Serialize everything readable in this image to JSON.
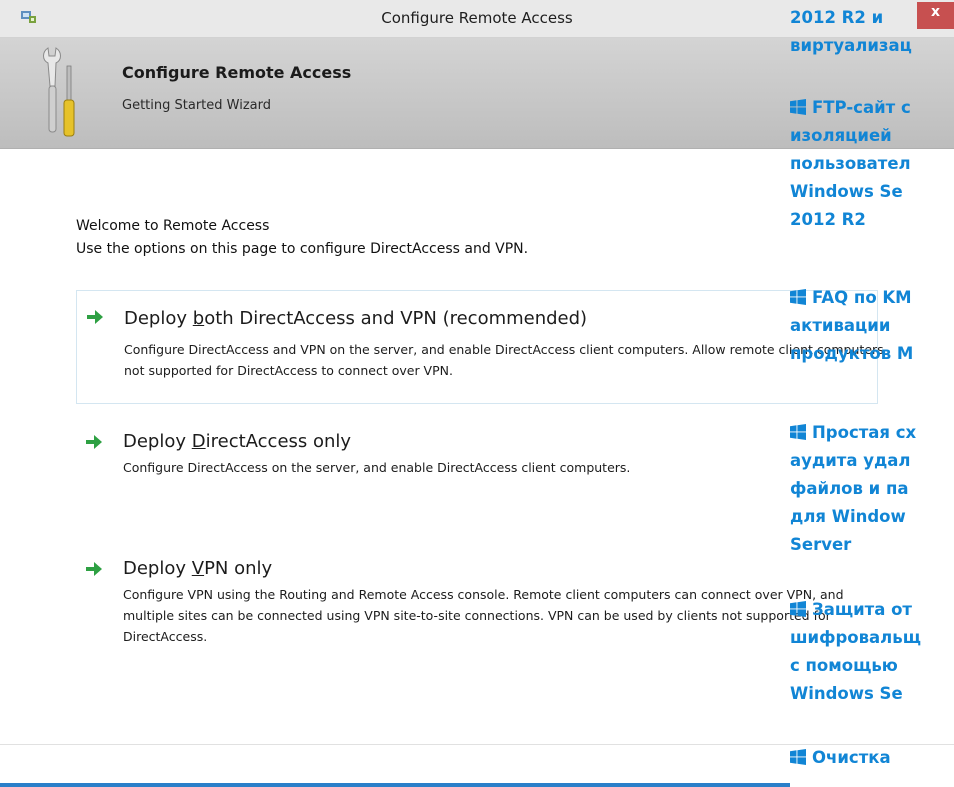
{
  "window": {
    "title": "Configure Remote Access",
    "close_label": "x"
  },
  "banner": {
    "title": "Configure Remote Access",
    "subtitle": "Getting Started Wizard"
  },
  "welcome": {
    "heading": "Welcome to Remote Access",
    "text": "Use the options on this page to configure DirectAccess and VPN."
  },
  "options": [
    {
      "title_before": "Deploy ",
      "title_accel": "b",
      "title_after": "oth DirectAccess and VPN (recommended)",
      "desc": "Configure DirectAccess and VPN on the server, and enable DirectAccess client computers. Allow remote client computers not supported for DirectAccess to connect over VPN."
    },
    {
      "title_before": "Deploy ",
      "title_accel": "D",
      "title_after": "irectAccess only",
      "desc": "Configure DirectAccess on the server, and enable DirectAccess client computers."
    },
    {
      "title_before": "Deploy ",
      "title_accel": "V",
      "title_after": "PN only",
      "desc": "Configure VPN using the Routing and Remote Access console. Remote client computers can connect over VPN, and multiple sites can be connected using VPN site-to-site connections. VPN can be used by clients not supported for DirectAccess."
    }
  ],
  "sidebar_links": {
    "l0_line1": "2012 R2 и",
    "l0_line2": "виртуализац",
    "l1_line1": "FTP-сайт с",
    "l1_line2": "изоляцией",
    "l1_line3": "пользовател",
    "l1_line4": "Windows Se",
    "l1_line5": "2012 R2",
    "l2_line1": "FAQ по KM",
    "l2_line2": "активации",
    "l2_line3": "продуктов M",
    "l3_line1": "Простая сх",
    "l3_line2": "аудита удал",
    "l3_line3": "файлов и па",
    "l3_line4": "для Window",
    "l3_line5": "Server",
    "l4_line1": "Защита от",
    "l4_line2": "шифровальщ",
    "l4_line3": "с помощью",
    "l4_line4": "Windows Se",
    "l5_line1": "Очистка"
  },
  "colors": {
    "link_blue": "#1185d5",
    "arrow_green": "#2ea043",
    "close_red": "#c75050"
  }
}
